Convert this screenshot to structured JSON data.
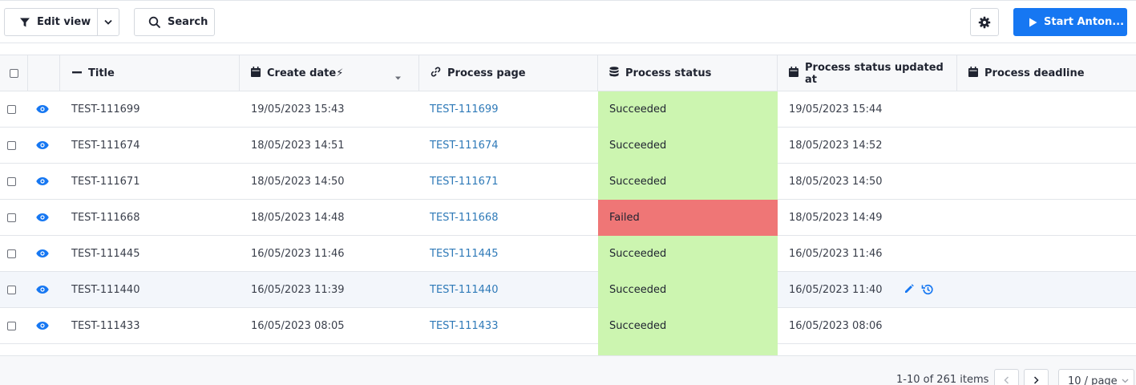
{
  "toolbar": {
    "edit_view_label": "Edit view",
    "search_label": "Search",
    "start_label": "Start Anton..."
  },
  "table": {
    "columns": [
      {
        "label": "Title",
        "icon": "minus-icon"
      },
      {
        "label": "Create date⚡",
        "icon": "calendar-icon"
      },
      {
        "label": "Process page",
        "icon": "link-icon"
      },
      {
        "label": "Process status",
        "icon": "database-icon"
      },
      {
        "label": "Process status updated at",
        "icon": "calendar-icon"
      },
      {
        "label": "Process deadline",
        "icon": "calendar-icon"
      }
    ],
    "rows": [
      {
        "title": "TEST-111699",
        "create_date": "19/05/2023 15:43",
        "process_page": "TEST-111699",
        "status": "Succeeded",
        "status_updated": "19/05/2023 15:44",
        "deadline": ""
      },
      {
        "title": "TEST-111674",
        "create_date": "18/05/2023 14:51",
        "process_page": "TEST-111674",
        "status": "Succeeded",
        "status_updated": "18/05/2023 14:52",
        "deadline": ""
      },
      {
        "title": "TEST-111671",
        "create_date": "18/05/2023 14:50",
        "process_page": "TEST-111671",
        "status": "Succeeded",
        "status_updated": "18/05/2023 14:50",
        "deadline": ""
      },
      {
        "title": "TEST-111668",
        "create_date": "18/05/2023 14:48",
        "process_page": "TEST-111668",
        "status": "Failed",
        "status_updated": "18/05/2023 14:49",
        "deadline": ""
      },
      {
        "title": "TEST-111445",
        "create_date": "16/05/2023 11:46",
        "process_page": "TEST-111445",
        "status": "Succeeded",
        "status_updated": "16/05/2023 11:46",
        "deadline": ""
      },
      {
        "title": "TEST-111440",
        "create_date": "16/05/2023 11:39",
        "process_page": "TEST-111440",
        "status": "Succeeded",
        "status_updated": "16/05/2023 11:40",
        "deadline": ""
      },
      {
        "title": "TEST-111433",
        "create_date": "16/05/2023 08:05",
        "process_page": "TEST-111433",
        "status": "Succeeded",
        "status_updated": "16/05/2023 08:06",
        "deadline": ""
      }
    ]
  },
  "pagination": {
    "info": "1-10 of 261 items",
    "page_size": "10 / page"
  },
  "colors": {
    "primary": "#1677f2",
    "succeeded": "#ccf5b0",
    "failed": "#ef7676",
    "link": "#2f7ab8"
  }
}
